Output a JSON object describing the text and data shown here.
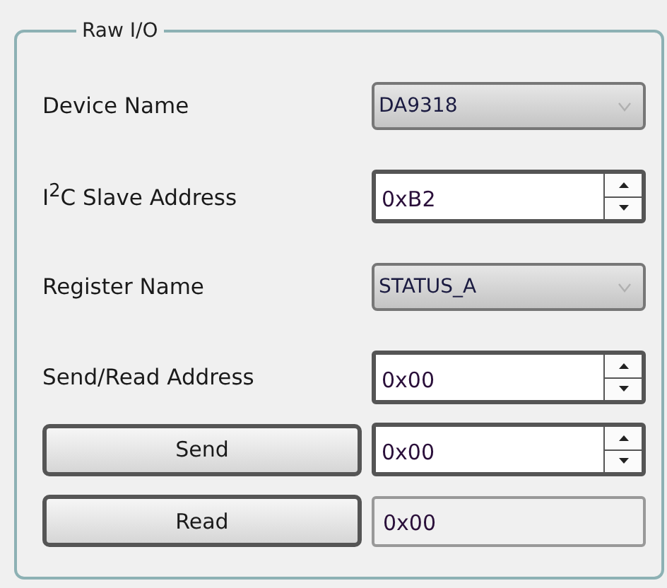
{
  "group": {
    "title": "Raw I/O"
  },
  "rows": [
    {
      "kind": "combo",
      "label": "Device Name",
      "value": "DA9318"
    },
    {
      "kind": "spin",
      "label": "I$^{2}$C Slave Address",
      "value": "0xB2"
    },
    {
      "kind": "combo",
      "label": "Register Name",
      "value": "STATUS_A"
    },
    {
      "kind": "spin",
      "label": "Send/Read Address",
      "value": "0x00"
    },
    {
      "kind": "button-spin",
      "button": "Send",
      "value": "0x00"
    },
    {
      "kind": "button-readonly",
      "button": "Read",
      "value": "0x00"
    }
  ]
}
